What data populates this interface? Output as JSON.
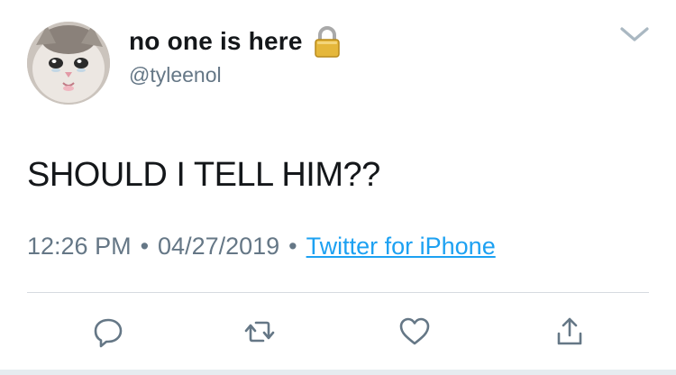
{
  "author": {
    "display_name": "no one is here",
    "username": "@tyleenol",
    "avatar": "crying-cat-avatar",
    "protected_icon": "lock-icon"
  },
  "tweet": {
    "text": "SHOULD I TELL HIM??",
    "time": "12:26 PM",
    "date": "04/27/2019",
    "separator": "•",
    "source": "Twitter for iPhone"
  },
  "actions": {
    "reply_icon": "reply-icon",
    "retweet_icon": "retweet-icon",
    "like_icon": "heart-icon",
    "share_icon": "share-icon",
    "more_icon": "chevron-down-icon"
  },
  "colors": {
    "text": "#14171a",
    "secondary": "#657786",
    "link": "#1da1f2",
    "divider": "#d6dbe0",
    "icon": "#657786"
  }
}
